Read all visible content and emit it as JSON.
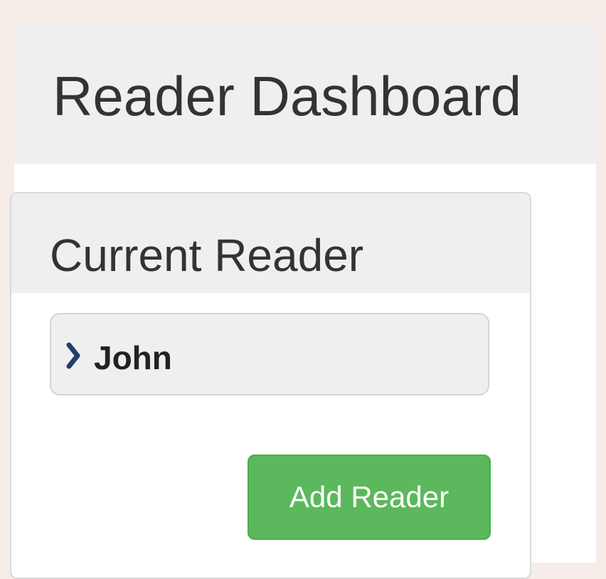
{
  "header": {
    "title": "Reader Dashboard"
  },
  "current_reader_panel": {
    "title": "Current Reader",
    "readers": [
      {
        "name": "John",
        "icon": "chevron-right-icon"
      }
    ],
    "add_button_label": "Add Reader"
  },
  "colors": {
    "background": "#f6ede8",
    "header_bg": "#efefef",
    "success_button": "#5cb85c",
    "chevron": "#1f3f6e"
  }
}
